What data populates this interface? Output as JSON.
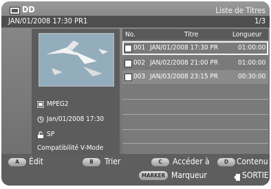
{
  "header": {
    "app_title": "DD",
    "screen_title": "Liste de Titres",
    "timestamp": "JAN/01/2008 17:30 PR1",
    "page": "1/3"
  },
  "preview": {
    "codec": "MPEG2",
    "datetime": "Jan/01/2008 17:30",
    "mode": "SP",
    "compat": "Compatibilité V-Mode"
  },
  "table": {
    "headers": {
      "no": "No.",
      "title": "Titre",
      "length": "Longueur"
    },
    "rows": [
      {
        "no": "001",
        "title": "JAN/01/2008 17:30 PR",
        "length": "01:00:00"
      },
      {
        "no": "002",
        "title": "JAN/02/2008 21:00 PR",
        "length": "01:00:00"
      },
      {
        "no": "003",
        "title": "JAN/03/2008 23:15 PR",
        "length": "00:30:00"
      }
    ]
  },
  "footer": {
    "a_key": "A",
    "a_label": "Édit",
    "b_key": "B",
    "b_label": "Trier",
    "c_key": "C",
    "c_label": "Accéder à",
    "d_key": "D",
    "d_label": "Contenu",
    "marker_key": "MARKER",
    "marker_label": "Marqueur",
    "exit_label": "SORTIE"
  }
}
